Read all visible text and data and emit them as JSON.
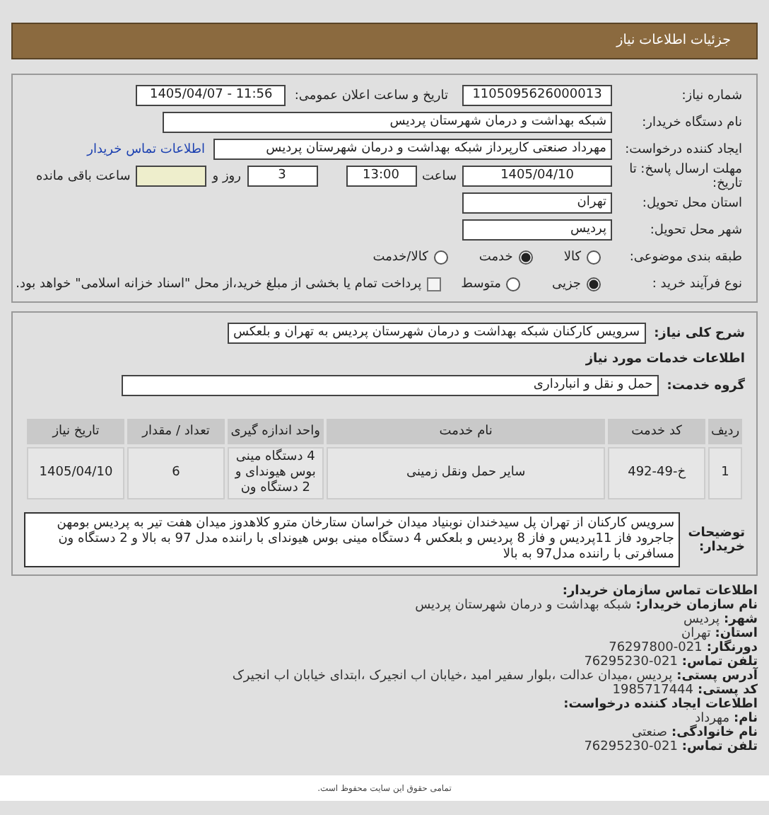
{
  "header": {
    "title": "جزئیات اطلاعات نیاز"
  },
  "need_number": {
    "label": "شماره نیاز:",
    "value": "1105095626000013"
  },
  "announce_date": {
    "label": "تاریخ و ساعت اعلان عمومی:",
    "value": "1405/04/07 - 11:56"
  },
  "buyer": {
    "label": "نام دستگاه خریدار:",
    "value": "شبکه بهداشت و درمان شهرستان پردیس"
  },
  "requester": {
    "label": "ایجاد کننده درخواست:",
    "value": "مهرداد صنعتی کارپرداز شبکه بهداشت و درمان شهرستان پردیس",
    "link": "اطلاعات تماس خریدار"
  },
  "deadline": {
    "label": "مهلت ارسال پاسخ: تا تاریخ:",
    "date": "1405/04/10",
    "time_label": "ساعت",
    "time": "13:00",
    "days": "3",
    "days_label": "روز و",
    "remaining_label": "ساعت باقی مانده"
  },
  "province": {
    "label": "استان محل تحویل:",
    "value": "تهران"
  },
  "city": {
    "label": "شهر محل تحویل:",
    "value": "پردیس"
  },
  "category": {
    "label": "طبقه بندی موضوعی:",
    "options": [
      {
        "label": "کالا",
        "selected": false
      },
      {
        "label": "خدمت",
        "selected": true
      },
      {
        "label": "کالا/خدمت",
        "selected": false
      }
    ]
  },
  "purchase_type": {
    "label": "نوع فرآیند خرید :",
    "options": [
      {
        "label": "جزیی",
        "selected": true
      },
      {
        "label": "متوسط",
        "selected": false
      }
    ],
    "payment": {
      "label": "پرداخت تمام یا بخشی از مبلغ خرید،از محل \"اسناد خزانه اسلامی\" خواهد بود.",
      "checked": false
    }
  },
  "summary": {
    "label": "شرح کلی نیاز:",
    "value": "سرویس کارکنان شبکه بهداشت و درمان شهرستان پردیس به تهران و بلعکس"
  },
  "services_heading": "اطلاعات خدمات مورد نیاز",
  "service_group": {
    "label": "گروه خدمت:",
    "value": "حمل و نقل و انبارداری"
  },
  "table": {
    "columns": [
      "ردیف",
      "کد خدمت",
      "نام خدمت",
      "واحد اندازه گیری",
      "تعداد / مقدار",
      "تاریخ نیاز"
    ],
    "rows": [
      [
        "1",
        "خ-49-492",
        "سایر حمل ونقل زمینی",
        "4 دستگاه مینی بوس هیوندای و 2 دستگاه ون",
        "6",
        "1405/04/10"
      ]
    ]
  },
  "description": {
    "label": "توضیحات خریدار:",
    "value": "سرویس کارکنان از تهران پل سیدخندان نوبنیاد میدان خراسان ستارخان مترو کلاهدوز میدان هفت تیر به پردیس بومهن جاجرود فاز 11پردیس و فاز 8 پردیس و بلعکس 4 دستگاه مینی بوس هیوندای با راننده مدل 97 به بالا و 2 دستگاه ون مسافرتی با راننده مدل97 به بالا"
  },
  "contact": {
    "title": "اطلاعات تماس سازمان خریدار:",
    "rows": [
      {
        "label": "نام سازمان خریدار:",
        "value": "شبکه بهداشت و درمان شهرستان پردیس"
      },
      {
        "label": "شهر:",
        "value": "پردیس"
      },
      {
        "label": "استان:",
        "value": "تهران"
      },
      {
        "label": "دورنگار:",
        "value": "76297800-021"
      },
      {
        "label": "تلفن تماس:",
        "value": "76295230-021"
      },
      {
        "label": "آدرس پستی:",
        "value": "پردیس ،میدان عدالت ،بلوار سفیر امید ،خیابان اب انجیرک ،ابتدای خیابان اب انجیرک"
      },
      {
        "label": "کد پستی:",
        "value": "1985717444"
      }
    ]
  },
  "creator": {
    "title": "اطلاعات ایجاد کننده درخواست:",
    "rows": [
      {
        "label": "نام:",
        "value": "مهرداد"
      },
      {
        "label": "نام خانوادگی:",
        "value": "صنعتی"
      },
      {
        "label": "تلفن تماس:",
        "value": "76295230-021"
      }
    ]
  },
  "footer": {
    "text": "تمامی حقوق این سایت محفوظ است."
  }
}
